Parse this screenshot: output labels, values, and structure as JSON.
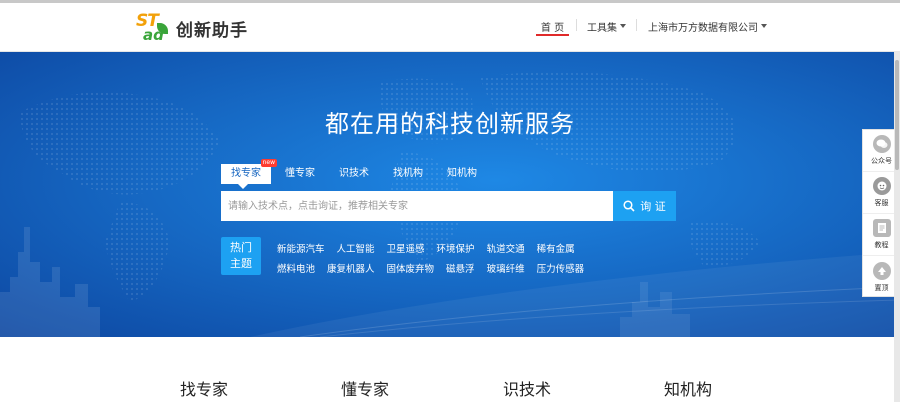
{
  "header": {
    "logo_text": "创新助手",
    "logo_mark_top": "ST",
    "logo_mark_bottom": "ad",
    "nav": {
      "home": "首 页",
      "tools": "工具集",
      "company": "上海市万方数据有限公司"
    }
  },
  "hero": {
    "title": "都在用的科技创新服务",
    "tabs": [
      {
        "label": "找专家",
        "active": true,
        "badge": "new"
      },
      {
        "label": "懂专家"
      },
      {
        "label": "识技术"
      },
      {
        "label": "找机构"
      },
      {
        "label": "知机构"
      }
    ],
    "search": {
      "placeholder": "请输入技术点，点击询证，推荐相关专家",
      "button": "询 证"
    },
    "hot": {
      "label_line1": "热门",
      "label_line2": "主题",
      "row1": [
        "新能源汽车",
        "人工智能",
        "卫星遥感",
        "环境保护",
        "轨道交通",
        "稀有金属"
      ],
      "row2": [
        "燃料电池",
        "康复机器人",
        "固体废弃物",
        "磁悬浮",
        "玻璃纤维",
        "压力传感器"
      ]
    }
  },
  "side_panel": [
    {
      "label": "公众号",
      "icon": "wechat-icon"
    },
    {
      "label": "客服",
      "icon": "customer-service-icon"
    },
    {
      "label": "教程",
      "icon": "tutorial-icon"
    },
    {
      "label": "置顶",
      "icon": "back-to-top-icon"
    }
  ],
  "sections": [
    "找专家",
    "懂专家",
    "识技术",
    "知机构"
  ],
  "colors": {
    "hero_blue": "#1565c0",
    "accent_cyan": "#1da1f2",
    "nav_underline": "#e02a2a",
    "logo_orange": "#f2a10a",
    "logo_green": "#3aa53a"
  }
}
